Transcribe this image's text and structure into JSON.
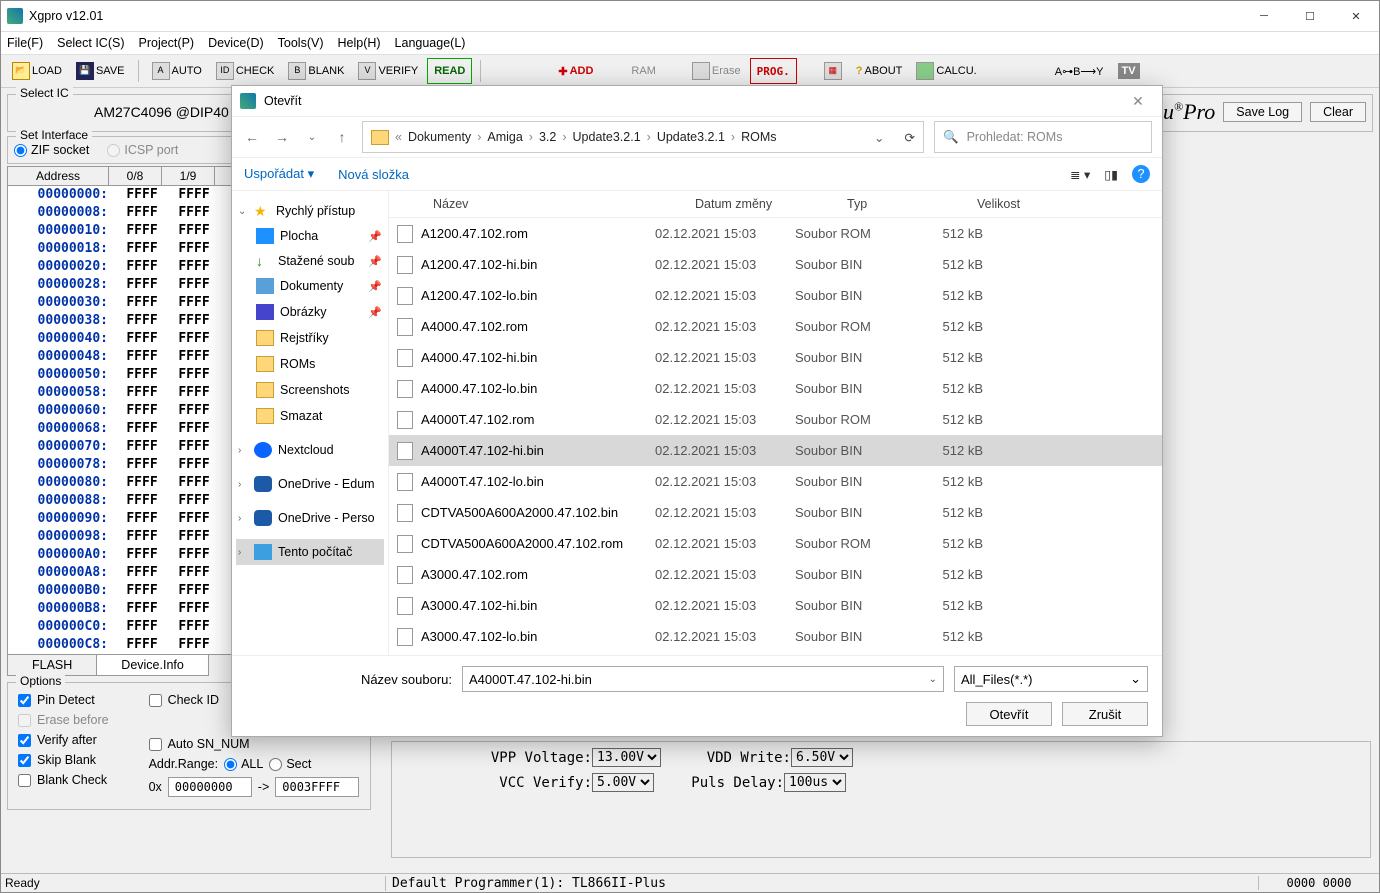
{
  "window": {
    "title": "Xgpro v12.01"
  },
  "menu": [
    "File(F)",
    "Select IC(S)",
    "Project(P)",
    "Device(D)",
    "Tools(V)",
    "Help(H)",
    "Language(L)"
  ],
  "toolbar": {
    "load": "LOAD",
    "save": "SAVE",
    "auto": "AUTO",
    "check": "CHECK",
    "blank": "BLANK",
    "verify": "VERIFY",
    "read": "READ",
    "add": "ADD",
    "ram": "RAM",
    "erase": "Erase",
    "prog": "PROG.",
    "about": "ABOUT",
    "calcu": "CALCU.",
    "tv": "TV"
  },
  "select_ic": {
    "legend": "Select IC",
    "ic": "AM27C4096  @DIP40",
    "brand_a": "XGecu",
    "brand_b": "Pro",
    "save_log_btn": "Save Log",
    "clear_btn": "Clear"
  },
  "iface": {
    "legend": "Set Interface",
    "zif": "ZIF socket",
    "icsp": "ICSP port"
  },
  "hex": {
    "head_addr": "Address",
    "heads": [
      "0/8",
      "1/9"
    ],
    "rows": [
      "00000000",
      "00000008",
      "00000010",
      "00000018",
      "00000020",
      "00000028",
      "00000030",
      "00000038",
      "00000040",
      "00000048",
      "00000050",
      "00000058",
      "00000060",
      "00000068",
      "00000070",
      "00000078",
      "00000080",
      "00000088",
      "00000090",
      "00000098",
      "000000A0",
      "000000A8",
      "000000B0",
      "000000B8",
      "000000C0",
      "000000C8"
    ],
    "val": "FFFF"
  },
  "tabs": {
    "flash": "FLASH",
    "device": "Device.Info"
  },
  "options": {
    "legend": "Options",
    "pin": "Pin Detect",
    "erase": "Erase before",
    "verify": "Verify after",
    "skip": "Skip Blank",
    "blank": "Blank Check",
    "checkid": "Check ID",
    "autosn": "Auto SN_NUM",
    "range_lbl": "Addr.Range:",
    "all": "ALL",
    "sect": "Sect",
    "hex_lbl": "0x",
    "from": "00000000",
    "arrow": "->",
    "to": "0003FFFF"
  },
  "settings": {
    "vpp_l": "VPP Voltage:",
    "vpp_v": "13.00V",
    "vdd_l": "VDD Write:",
    "vdd_v": "6.50V",
    "vcc_l": "VCC Verify:",
    "vcc_v": "5.00V",
    "pls_l": "Puls Delay:",
    "pls_v": "100us"
  },
  "status": {
    "ready": "Ready",
    "prog": "Default Programmer(1): TL866II-Plus",
    "coords": "0000 0000"
  },
  "dialog": {
    "title": "Otevřít",
    "crumbs": [
      "Dokumenty",
      "Amiga",
      "3.2",
      "Update3.2.1",
      "Update3.2.1",
      "ROMs"
    ],
    "search_ph": "Prohledat: ROMs",
    "organize": "Uspořádat",
    "newfolder": "Nová složka",
    "tree": {
      "quick": "Rychlý přístup",
      "desktop": "Plocha",
      "downloads": "Stažené soub",
      "documents": "Dokumenty",
      "pictures": "Obrázky",
      "rejstriky": "Rejstříky",
      "roms": "ROMs",
      "screenshots": "Screenshots",
      "smazat": "Smazat",
      "nextcloud": "Nextcloud",
      "od1": "OneDrive - Edum",
      "od2": "OneDrive - Perso",
      "pc": "Tento počítač"
    },
    "cols": {
      "name": "Název",
      "date": "Datum změny",
      "type": "Typ",
      "size": "Velikost"
    },
    "files": [
      {
        "n": "A1200.47.102.rom",
        "d": "02.12.2021 15:03",
        "t": "Soubor ROM",
        "s": "512 kB"
      },
      {
        "n": "A1200.47.102-hi.bin",
        "d": "02.12.2021 15:03",
        "t": "Soubor BIN",
        "s": "512 kB"
      },
      {
        "n": "A1200.47.102-lo.bin",
        "d": "02.12.2021 15:03",
        "t": "Soubor BIN",
        "s": "512 kB"
      },
      {
        "n": "A4000.47.102.rom",
        "d": "02.12.2021 15:03",
        "t": "Soubor ROM",
        "s": "512 kB"
      },
      {
        "n": "A4000.47.102-hi.bin",
        "d": "02.12.2021 15:03",
        "t": "Soubor BIN",
        "s": "512 kB"
      },
      {
        "n": "A4000.47.102-lo.bin",
        "d": "02.12.2021 15:03",
        "t": "Soubor BIN",
        "s": "512 kB"
      },
      {
        "n": "A4000T.47.102.rom",
        "d": "02.12.2021 15:03",
        "t": "Soubor ROM",
        "s": "512 kB"
      },
      {
        "n": "A4000T.47.102-hi.bin",
        "d": "02.12.2021 15:03",
        "t": "Soubor BIN",
        "s": "512 kB",
        "sel": true
      },
      {
        "n": "A4000T.47.102-lo.bin",
        "d": "02.12.2021 15:03",
        "t": "Soubor BIN",
        "s": "512 kB"
      },
      {
        "n": "CDTVA500A600A2000.47.102.bin",
        "d": "02.12.2021 15:03",
        "t": "Soubor BIN",
        "s": "512 kB"
      },
      {
        "n": "CDTVA500A600A2000.47.102.rom",
        "d": "02.12.2021 15:03",
        "t": "Soubor ROM",
        "s": "512 kB"
      },
      {
        "n": "A3000.47.102.rom",
        "d": "02.12.2021 15:03",
        "t": "Soubor BIN",
        "s": "512 kB"
      },
      {
        "n": "A3000.47.102-hi.bin",
        "d": "02.12.2021 15:03",
        "t": "Soubor BIN",
        "s": "512 kB"
      },
      {
        "n": "A3000.47.102-lo.bin",
        "d": "02.12.2021 15:03",
        "t": "Soubor BIN",
        "s": "512 kB"
      }
    ],
    "fn_lbl": "Název souboru:",
    "fn_val": "A4000T.47.102-hi.bin",
    "filter": "All_Files(*.*)",
    "open": "Otevřít",
    "cancel": "Zrušit"
  }
}
